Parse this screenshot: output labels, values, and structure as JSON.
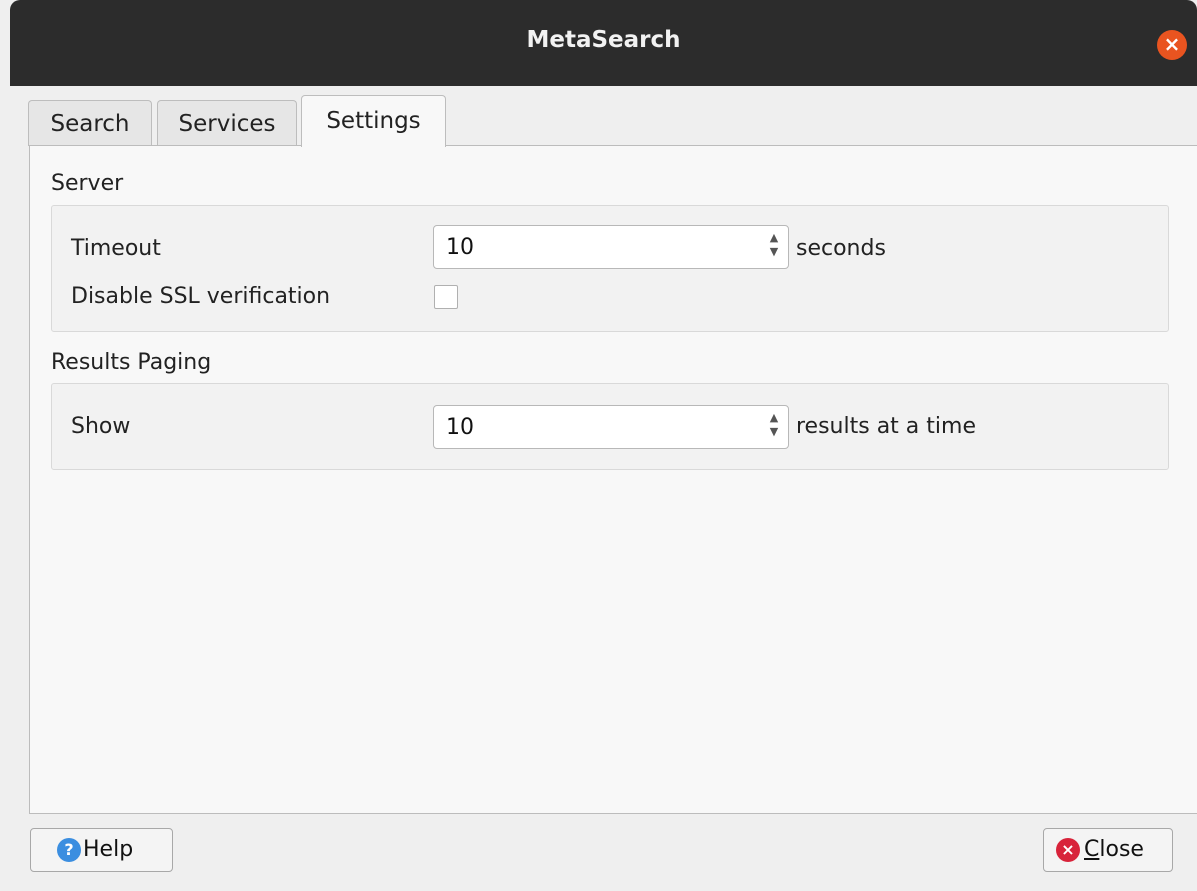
{
  "window": {
    "title": "MetaSearch"
  },
  "tabs": [
    {
      "label": "Search",
      "active": false
    },
    {
      "label": "Services",
      "active": false
    },
    {
      "label": "Settings",
      "active": true
    }
  ],
  "settings": {
    "server": {
      "title": "Server",
      "timeout_label": "Timeout",
      "timeout_value": "10",
      "timeout_suffix": "seconds",
      "ssl_label": "Disable SSL verification",
      "ssl_checked": false
    },
    "paging": {
      "title": "Results Paging",
      "show_label": "Show",
      "show_value": "10",
      "show_suffix": "results at a time"
    }
  },
  "buttons": {
    "help_label": "Help",
    "close_label_underlined": "C",
    "close_label_rest": "lose"
  },
  "colors": {
    "titlebar": "#2c2c2c",
    "window_close": "#e95420",
    "help_icon": "#3b8ee0",
    "close_icon": "#d8233a"
  },
  "icons": {
    "window_close": "close-icon",
    "help": "help-icon",
    "close": "error-icon"
  }
}
